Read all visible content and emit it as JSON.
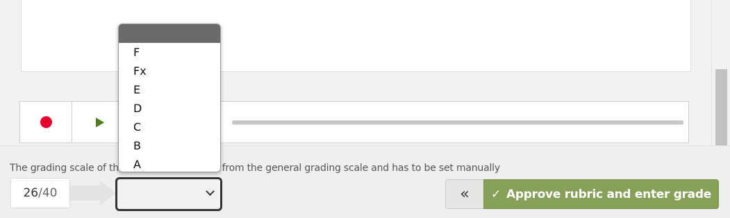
{
  "player": {
    "record_icon": "record-dot-icon",
    "play_icon": "play-triangle-icon",
    "record_color": "#e5002b",
    "play_color": "#4f7d1a"
  },
  "notice": {
    "text": "The grading scale of this exam/rubric differs from the general grading scale and has to be set manually"
  },
  "score": {
    "value": "26",
    "separator": "/",
    "max": "40"
  },
  "grade_select": {
    "selected": "",
    "options": [
      "",
      "F",
      "Fx",
      "E",
      "D",
      "C",
      "B",
      "A"
    ]
  },
  "buttons": {
    "back_label": "«",
    "approve_check": "✓",
    "approve_label": "Approve rubric and enter grade",
    "approve_color": "#86a05a"
  }
}
